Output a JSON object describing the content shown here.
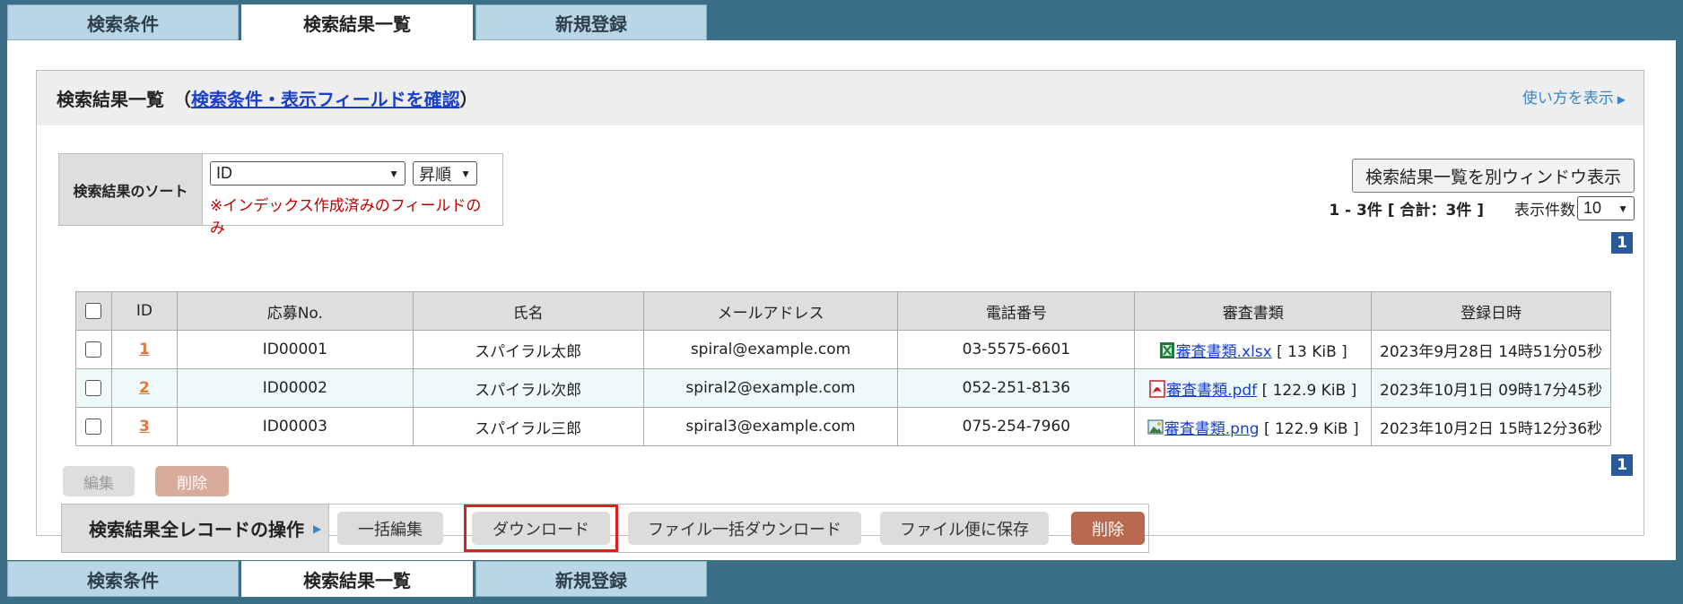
{
  "tabs": [
    "検索条件",
    "検索結果一覧",
    "新規登録"
  ],
  "active_tab": 1,
  "panel": {
    "title": "検索結果一覧",
    "paren_open": "（",
    "paren_close": "）",
    "link": "検索条件・表示フィールドを確認",
    "howto": "使い方を表示"
  },
  "sort": {
    "label": "検索結果のソート",
    "field_value": "ID",
    "order_value": "昇順",
    "note": "※インデックス作成済みのフィールドのみ"
  },
  "window_button": "検索結果一覧を別ウィンドウ表示",
  "count_text": "1 - 3件 [ 合計：3件 ]",
  "perpage_label": "表示件数",
  "perpage_value": "10",
  "page_number": "1",
  "table": {
    "headers": [
      "ID",
      "応募No.",
      "氏名",
      "メールアドレス",
      "電話番号",
      "審査書類",
      "登録日時"
    ],
    "rows": [
      {
        "id": "1",
        "no": "ID00001",
        "name": "スパイラル太郎",
        "email": "spiral@example.com",
        "phone": "03-5575-6601",
        "file": "審査書類.xlsx",
        "size": "[ 13 KiB ]",
        "file_icon": "excel-icon",
        "date": "2023年9月28日 14時51分05秒"
      },
      {
        "id": "2",
        "no": "ID00002",
        "name": "スパイラル次郎",
        "email": "spiral2@example.com",
        "phone": "052-251-8136",
        "file": "審査書類.pdf",
        "size": "[ 122.9 KiB ]",
        "file_icon": "pdf-icon",
        "date": "2023年10月1日 09時17分45秒"
      },
      {
        "id": "3",
        "no": "ID00003",
        "name": "スパイラル三郎",
        "email": "spiral3@example.com",
        "phone": "075-254-7960",
        "file": "審査書類.png",
        "size": "[ 122.9 KiB ]",
        "file_icon": "image-icon",
        "date": "2023年10月2日 15時12分36秒"
      }
    ]
  },
  "row_buttons": {
    "edit": "編集",
    "delete": "削除"
  },
  "ops": {
    "label": "検索結果全レコードの操作",
    "bulk_edit": "一括編集",
    "download": "ダウンロード",
    "file_bulk_download": "ファイル一括ダウンロード",
    "save_to_file_bin": "ファイル便に保存",
    "delete": "削除"
  },
  "colors": {
    "accent": "#3b6e87",
    "highlight": "#e02020",
    "danger": "#b8694f",
    "link": "#1a3fc8"
  }
}
